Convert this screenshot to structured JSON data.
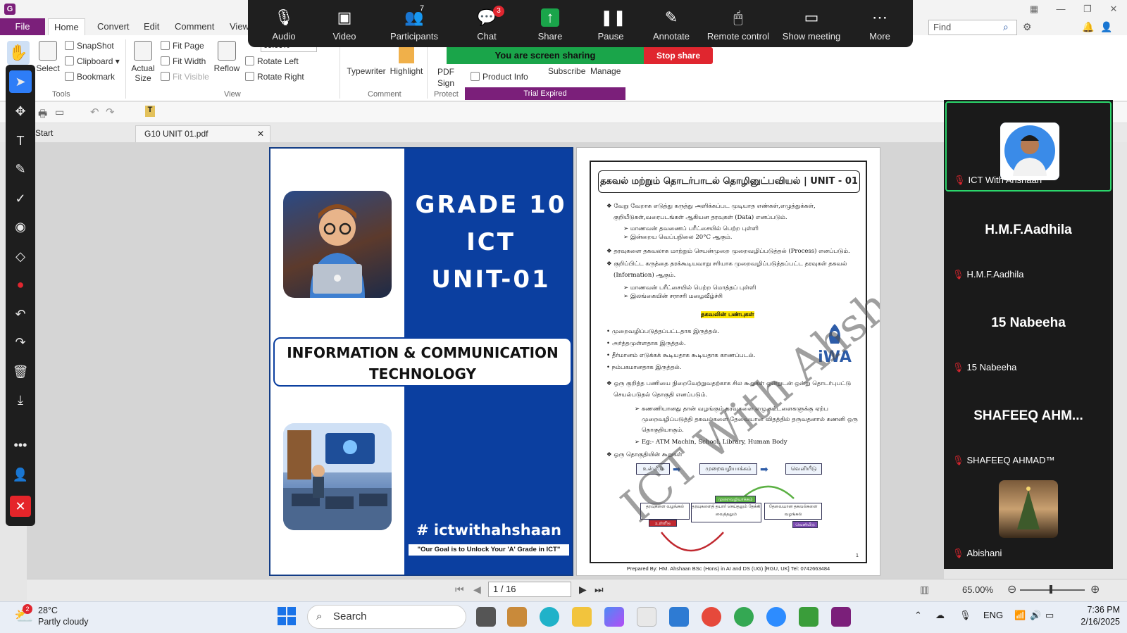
{
  "app": {
    "menu_tabs": [
      "File",
      "Home",
      "Convert",
      "Edit",
      "Comment",
      "View"
    ],
    "find_placeholder": "Find"
  },
  "ribbon": {
    "tools": {
      "hand": "",
      "select": "Select",
      "snapshot": "SnapShot",
      "clipboard": "Clipboard",
      "bookmark": "Bookmark",
      "group": "Tools"
    },
    "view": {
      "actual_size": "Actual Size",
      "fit_page": "Fit Page",
      "fit_width": "Fit Width",
      "fit_visible": "Fit Visible",
      "reflow": "Reflow",
      "zoom_value": "65.00%",
      "rotate_left": "Rotate Left",
      "rotate_right": "Rotate Right",
      "group": "View"
    },
    "comment": {
      "typewriter": "Typewriter",
      "highlight": "Highlight",
      "group": "Comment"
    },
    "protect": {
      "pdf_sign": "PDF Sign",
      "group": "Protect"
    },
    "other": {
      "product_info": "Product Info",
      "subscribe": "Subscribe",
      "manage": "Manage",
      "trial": "Trial Expired"
    }
  },
  "doc_tabs": {
    "start": "Start",
    "file": "G10 UNIT 01.pdf"
  },
  "zoom_meeting": {
    "buttons": [
      {
        "label": "Audio",
        "icon": "mic-muted-icon"
      },
      {
        "label": "Video",
        "icon": "video-off-icon"
      },
      {
        "label": "Participants",
        "icon": "participants-icon",
        "count": "7"
      },
      {
        "label": "Chat",
        "icon": "chat-icon",
        "badge": "3"
      },
      {
        "label": "Share",
        "icon": "share-icon"
      },
      {
        "label": "Pause",
        "icon": "pause-icon"
      },
      {
        "label": "Annotate",
        "icon": "pen-icon"
      },
      {
        "label": "Remote control",
        "icon": "mouse-icon"
      },
      {
        "label": "Show meeting",
        "icon": "window-icon"
      },
      {
        "label": "More",
        "icon": "more-icon"
      }
    ],
    "sharing_text": "You are screen sharing",
    "stop_share": "Stop share"
  },
  "page1": {
    "grade": "GRADE 10",
    "ict": "ICT",
    "unit": "UNIT-01",
    "band_line1": "INFORMATION & COMMUNICATION",
    "band_line2": "TECHNOLOGY",
    "hashtag": "# ictwithahshaan",
    "goal": "\"Our Goal is to Unlock Your 'A' Grade in ICT\""
  },
  "page2": {
    "title": "தகவல் மற்றும் தொடர்பாடல் தொழினுட்பவியல் | UNIT - 01",
    "lines": [
      "❖ வேறு வேறாக எடுத்து கருத்து அளிக்கப்பட முடியாத எண்கள்,எழுத்துக்கள்,",
      "குறியீடுகள்,வரைபடங்கள் ஆகியன தரவுகள் (Data) எனப்படும்.",
      "➢ மாணவன் தவணைப் பரீட்சையில் பெற்ற புள்ளி",
      "➢ இன்றைய வெப்பநிலை 20°C ஆகும்.",
      "❖ தரவுகளை தகவலாக மாற்றும் செயன்முறை முறைவழிப்படுத்தல் (Process) எனப்படும்.",
      "❖ குறிப்பிட்ட கருத்தை தரக்கூடியவாறு சரியாக முறைவழிப்படுத்தப்பட்ட தரவுகள் தகவல்",
      "(Information) ஆகும்.",
      "➢ மாணவன் பரீட்சையில் பெற்ற மொத்தப் புள்ளி",
      "➢ இலங்கையின் சராசரி மழைவீழ்ச்சி"
    ],
    "highlight": "தகவலின் பண்புகள்",
    "bullets": [
      "• முறைவழிப்படுத்தப்பட்டதாக இருத்தல்.",
      "• அர்த்தமுள்ளதாக இருத்தல்.",
      "• தீர்மானம் எடுக்கக் கூடியதாக கூடியதாக காணப்படல்.",
      "• நம்பகமானதாக இருத்தல்."
    ],
    "lines2": [
      "❖ ஒரு குறித்த பணியை நிறைவேற்றுவதற்காக சில கூறுகள் ஒன்றுடன் ஒன்று தொடர்புபட்டு",
      "செயல்படுதல் தொகுதி எனப்படும்.",
      "➢ கணணியானது தான் வழங்கும் தரவுகளை எழு கட்டளைகளுக்கு ஏற்ப",
      "முறைவழிப்படுத்தி தகவல்களை தேவையான விதத்தில் தருவதனால் கணனி ஒரு",
      "தொகுதியாகும்.",
      "➢ Eg:- ATM Machin, School, Library, Human Body",
      "❖ ஒரு தொகுதியின் கூறுகள்"
    ],
    "flow": [
      "உள்ளீடு",
      "முறைவழியாக்கம்",
      "வெளியீடு"
    ],
    "cycle": [
      "முறைவழியாக்கம்",
      "தரவுகளை வழங்கல்",
      "தரவுகளைத் தயார் செய்தலும் தேக்கி வைத்தலும்",
      "தேவையான தகவல்களை வழங்கல்",
      "உள்ளீடு",
      "வெளியீடு"
    ],
    "watermark": "ICT With Ahshaan",
    "logo_text": "iWA",
    "page_number": "1",
    "footer": "Prepared By: HM. Ahshaan BSc (Hons) in AI and DS (UG) [RGU, UK] Tel: 0742663484"
  },
  "page_nav": {
    "page": "1 / 16",
    "zoom": "65.00%"
  },
  "participants": [
    {
      "name": "ICT With Ahshaan",
      "big": "",
      "active": true
    },
    {
      "name": "H.M.F.Aadhila",
      "big": "H.M.F.Aadhila"
    },
    {
      "name": "15 Nabeeha",
      "big": "15 Nabeeha"
    },
    {
      "name": "SHAFEEQ AHMAD™",
      "big": "SHAFEEQ AHM..."
    },
    {
      "name": "Abishani",
      "big": ""
    }
  ],
  "taskbar": {
    "weather_badge": "2",
    "temp": "28°C",
    "condition": "Partly cloudy",
    "search": "Search",
    "lang": "ENG",
    "time": "7:36 PM",
    "date": "2/16/2025"
  },
  "colors": {
    "brand": "#7b1f7a",
    "zoom_bg": "#1f1f1f",
    "share_green": "#1aa54a",
    "stop_red": "#e0262f",
    "cover_blue": "#0b3fa0"
  }
}
